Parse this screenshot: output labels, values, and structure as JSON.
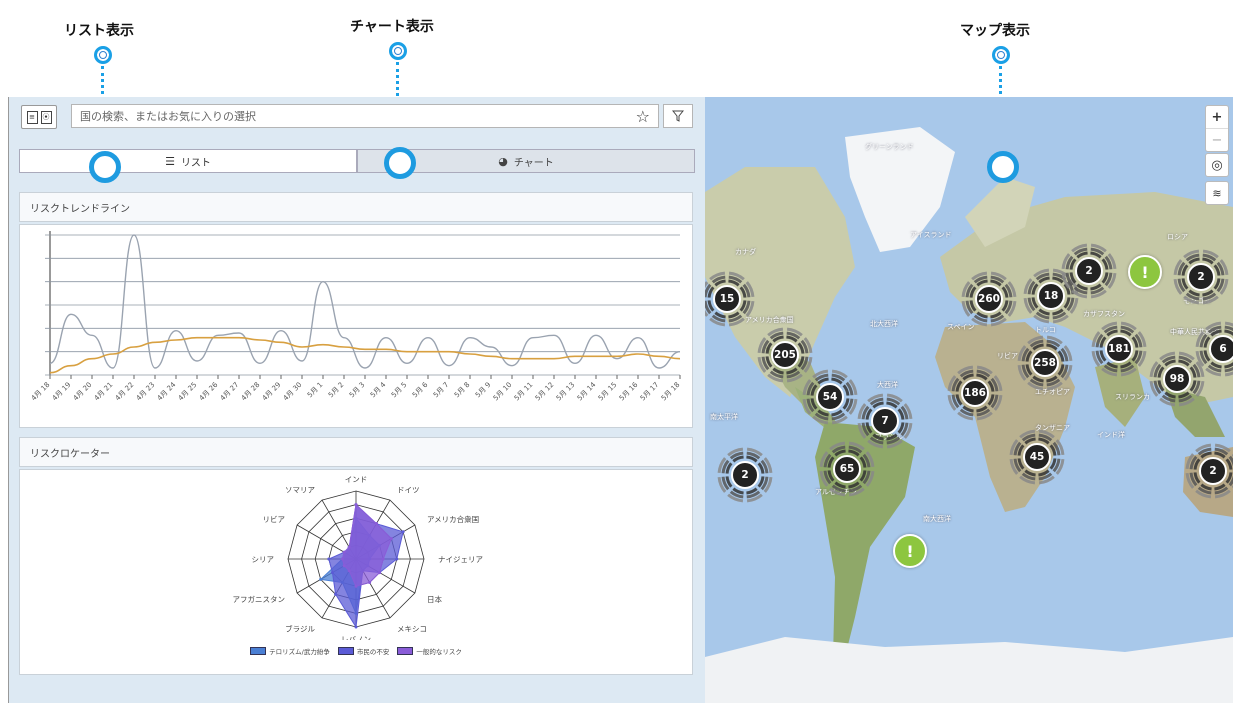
{
  "callouts": {
    "list": "リスト表示",
    "chart": "チャート表示",
    "map": "マップ表示"
  },
  "toolbar": {
    "search_placeholder": "国の検索、またはお気に入りの選択",
    "star_icon": "star-icon",
    "filter_icon": "filter-icon",
    "toggle_icon": "list-map-toggle-icon"
  },
  "tabs": [
    {
      "label": "リスト",
      "icon": "list-icon",
      "active": true
    },
    {
      "label": "チャート",
      "icon": "pie-chart-icon",
      "active": false
    }
  ],
  "trend_panel": {
    "title": "リスクトレンドライン"
  },
  "locator_panel": {
    "title": "リスクロケーター"
  },
  "chart_data": [
    {
      "type": "line",
      "title": "リスクトレンドライン",
      "x": [
        "4月 18",
        "4月 19",
        "4月 20",
        "4月 21",
        "4月 22",
        "4月 23",
        "4月 24",
        "4月 25",
        "4月 26",
        "4月 27",
        "4月 28",
        "4月 29",
        "4月 30",
        "5月 1",
        "5月 2",
        "5月 3",
        "5月 4",
        "5月 5",
        "5月 6",
        "5月 7",
        "5月 8",
        "5月 9",
        "5月 10",
        "5月 11",
        "5月 12",
        "5月 13",
        "5月 14",
        "5月 15",
        "5月 16",
        "5月 17",
        "5月 18"
      ],
      "ylim": [
        0,
        6
      ],
      "grid": true,
      "series": [
        {
          "color": "#9aa3b0",
          "values": [
            0.5,
            2.6,
            1.7,
            0.3,
            6,
            0.3,
            1.9,
            0.6,
            1.7,
            1.8,
            0.5,
            1.9,
            0.6,
            4,
            1.6,
            0.3,
            1.6,
            0.5,
            1.6,
            0.4,
            1.6,
            1.2,
            0.4,
            1.6,
            1.7,
            0.5,
            1.7,
            0.7,
            1.6,
            0.3,
            1.0
          ]
        },
        {
          "color": "#d8a040",
          "values": [
            0.1,
            0.4,
            0.7,
            0.9,
            1.2,
            1.4,
            1.5,
            1.6,
            1.6,
            1.6,
            1.5,
            1.4,
            1.2,
            1.3,
            1.2,
            1.1,
            1.1,
            1.0,
            1.0,
            1.0,
            0.9,
            0.8,
            0.7,
            0.7,
            0.7,
            0.8,
            0.8,
            0.8,
            0.9,
            0.8,
            0.7
          ]
        }
      ]
    },
    {
      "type": "radar",
      "title": "リスクロケーター",
      "categories": [
        "インド",
        "ドイツ",
        "アメリカ合衆国",
        "ナイジェリア",
        "日本",
        "メキシコ",
        "レバノン",
        "ブラジル",
        "アフガニスタン",
        "シリア",
        "リビア",
        "ソマリア"
      ],
      "rmax": 5,
      "series": [
        {
          "name": "テロリズム/武力紛争",
          "color": "#4a7fd4",
          "values": [
            3,
            2,
            2,
            1,
            1,
            1,
            4,
            2,
            3,
            1,
            1,
            1
          ]
        },
        {
          "name": "市民の不安",
          "color": "#5b5bd6",
          "values": [
            4,
            3,
            4,
            3,
            2,
            1,
            5,
            3,
            2,
            2,
            1,
            1
          ]
        },
        {
          "name": "一般的なリスク",
          "color": "#8a5cd8",
          "values": [
            4,
            3,
            3,
            2,
            2,
            2,
            2,
            1,
            1,
            1,
            1,
            1
          ]
        }
      ]
    }
  ],
  "map": {
    "labels": {
      "greenland": "グリーンランド",
      "canada": "カナダ",
      "america": "アメリカ合衆国",
      "iceland": "アイスランド",
      "russia": "ロシア",
      "mongolia": "モンゴル",
      "china": "中華人民共和国",
      "turkey": "トルコ",
      "libya": "リビア",
      "spain": "スペイン",
      "ethiopia": "エチオピア",
      "tanzania": "タンザニア",
      "indian_ocean": "インド洋",
      "atlantic_n": "北大西洋",
      "atlantic": "大西洋",
      "atlantic_s": "南大西洋",
      "pacific_s": "南太平洋",
      "srilanka": "スリランカ",
      "brazil": "ブラジル",
      "argentina": "アルゼンチン",
      "kazakh": "カザフスタン"
    },
    "clusters": [
      {
        "count": "15"
      },
      {
        "count": "205"
      },
      {
        "count": "54"
      },
      {
        "count": "7"
      },
      {
        "count": "65"
      },
      {
        "count": "2"
      },
      {
        "count": "260"
      },
      {
        "count": "18"
      },
      {
        "count": "2"
      },
      {
        "count": "2"
      },
      {
        "count": "258"
      },
      {
        "count": "186"
      },
      {
        "count": "181"
      },
      {
        "count": "98"
      },
      {
        "count": "6"
      },
      {
        "count": "45"
      },
      {
        "count": "2"
      }
    ],
    "alert_symbol": "!",
    "controls": {
      "zoom_in": "+",
      "zoom_out": "−"
    }
  }
}
